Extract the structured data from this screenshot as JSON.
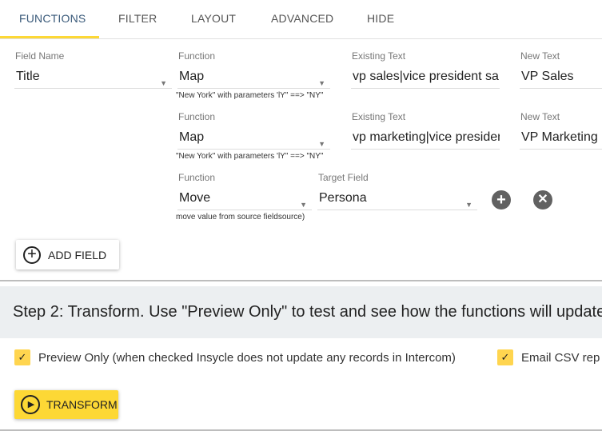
{
  "tabs": [
    {
      "label": "FUNCTIONS",
      "active": true
    },
    {
      "label": "FILTER"
    },
    {
      "label": "LAYOUT"
    },
    {
      "label": "ADVANCED"
    },
    {
      "label": "HIDE"
    }
  ],
  "labels": {
    "field_name": "Field Name",
    "function": "Function",
    "existing_text": "Existing Text",
    "new_text": "New Text",
    "target_field": "Target Field"
  },
  "rows": [
    {
      "field_name": "Title",
      "function": "Map",
      "existing_text": "vp sales|vice president sa",
      "new_text": "VP Sales",
      "help": "\"New York\" with parameters 'lY\" ==> \"NY\""
    },
    {
      "function": "Map",
      "existing_text": "vp marketing|vice presiden",
      "new_text": "VP Marketing",
      "help": "\"New York\" with parameters 'lY\" ==> \"NY\""
    },
    {
      "function": "Move",
      "target_field": "Persona",
      "help": "move value from source fieldsource)"
    }
  ],
  "add_field": "ADD FIELD",
  "step2": {
    "title": "Step 2: Transform. Use \"Preview Only\" to test and see how the functions will update",
    "preview_only": "Preview Only (when checked Insycle does not update any records in Intercom)",
    "preview_checked": true,
    "email_csv": "Email CSV rep",
    "email_checked": true,
    "transform": "TRANSFORM"
  },
  "colors": {
    "accent": "#fdd835",
    "checkbox": "#ffd54f",
    "band": "#eceff1"
  }
}
